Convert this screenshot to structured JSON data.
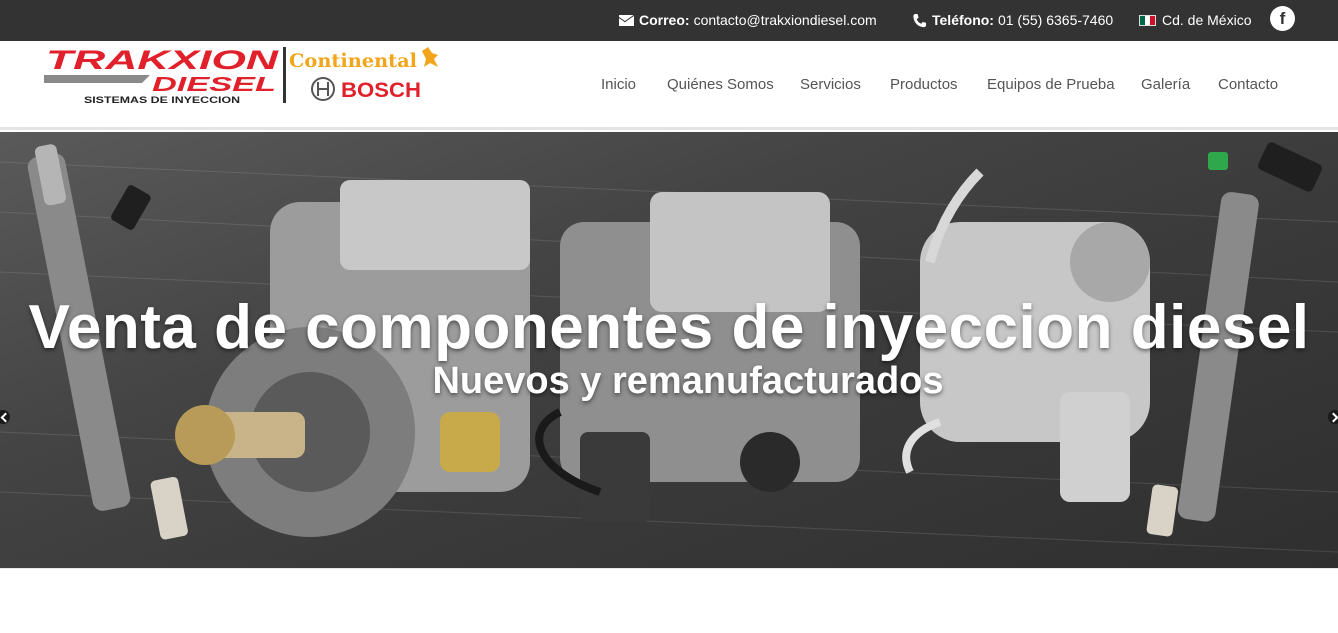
{
  "topbar": {
    "email_label": "Correo:",
    "email_value": "contacto@trakxiondiesel.com",
    "phone_label": "Teléfono:",
    "phone_value": "01 (55) 6365-7460",
    "location": "Cd. de México",
    "facebook_glyph": "f"
  },
  "logo": {
    "brand_top": "TRAKXION",
    "brand_bottom": "DIESEL",
    "tagline": "SISTEMAS DE INYECCION",
    "partner1": "Continental",
    "partner2": "BOSCH"
  },
  "nav": {
    "items": [
      {
        "label": "Inicio"
      },
      {
        "label": "Quiénes Somos"
      },
      {
        "label": "Servicios"
      },
      {
        "label": "Productos"
      },
      {
        "label": "Equipos de Prueba"
      },
      {
        "label": "Galería"
      },
      {
        "label": "Contacto"
      }
    ]
  },
  "hero": {
    "title": "Venta de componentes de inyeccion diesel",
    "subtitle": "Nuevos y remanufacturados"
  },
  "colors": {
    "topbar_bg": "#333333",
    "brand_red": "#e0202a",
    "continental_orange": "#f2a51b",
    "nav_text": "#555555"
  }
}
